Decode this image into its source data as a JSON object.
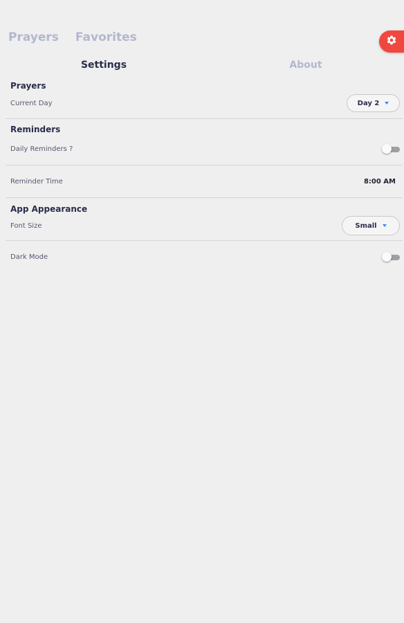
{
  "nav": {
    "prayers": "Prayers",
    "favorites": "Favorites"
  },
  "tabs": {
    "settings": "Settings",
    "about": "About"
  },
  "accent_color": "#f0483e",
  "sections": {
    "prayers": {
      "title": "Prayers",
      "current_day_label": "Current Day",
      "current_day_value": "Day 2"
    },
    "reminders": {
      "title": "Reminders",
      "daily_label": "Daily Reminders ?",
      "daily_enabled": false,
      "time_label": "Reminder Time",
      "time_value": "8:00 AM"
    },
    "appearance": {
      "title": "App Appearance",
      "font_size_label": "Font Size",
      "font_size_value": "Small",
      "dark_mode_label": "Dark Mode",
      "dark_mode_enabled": false
    }
  }
}
